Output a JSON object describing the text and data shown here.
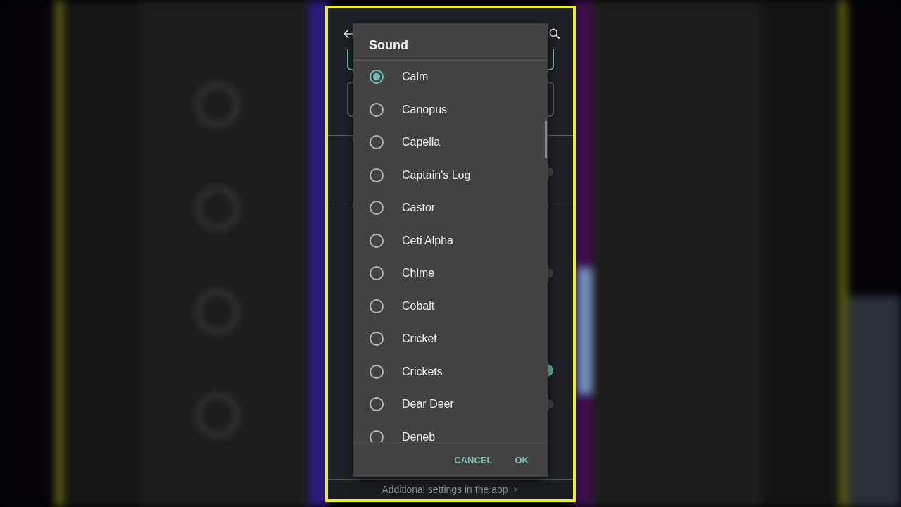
{
  "settings": {
    "fields": [
      {
        "selected": true
      },
      {
        "selected": false
      }
    ],
    "switches": [
      {
        "on": false
      },
      {
        "on": false
      },
      {
        "on": true
      },
      {
        "on": false
      }
    ],
    "footer_link": "Additional settings in the app"
  },
  "dialog": {
    "title": "Sound",
    "options": [
      {
        "label": "Calm",
        "selected": true
      },
      {
        "label": "Canopus",
        "selected": false
      },
      {
        "label": "Capella",
        "selected": false
      },
      {
        "label": "Captain's Log",
        "selected": false
      },
      {
        "label": "Castor",
        "selected": false
      },
      {
        "label": "Ceti Alpha",
        "selected": false
      },
      {
        "label": "Chime",
        "selected": false
      },
      {
        "label": "Cobalt",
        "selected": false
      },
      {
        "label": "Cricket",
        "selected": false
      },
      {
        "label": "Crickets",
        "selected": false
      },
      {
        "label": "Dear Deer",
        "selected": false
      },
      {
        "label": "Deneb",
        "selected": false
      }
    ],
    "buttons": [
      "CANCEL",
      "OK"
    ]
  }
}
